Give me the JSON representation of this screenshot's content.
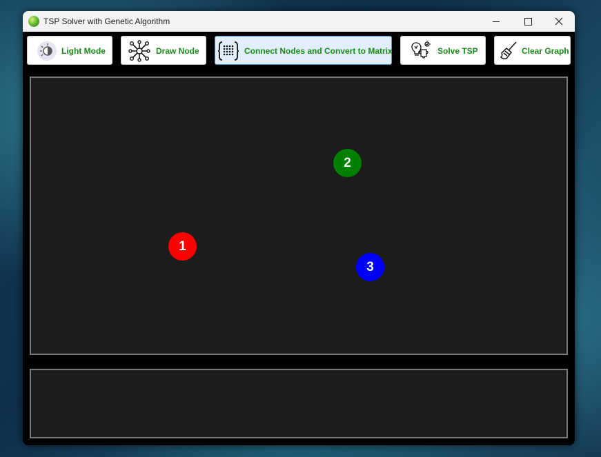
{
  "window": {
    "title": "TSP Solver with Genetic Algorithm"
  },
  "toolbar": {
    "buttons": [
      {
        "label": "Light Mode",
        "icon": "light-mode-icon",
        "active": false
      },
      {
        "label": "Draw Node",
        "icon": "network-nodes-icon",
        "active": false
      },
      {
        "label": "Connect Nodes and Convert to Matrix",
        "icon": "matrix-braces-icon",
        "active": true
      },
      {
        "label": "Solve TSP",
        "icon": "lightbulb-puzzle-icon",
        "active": false
      },
      {
        "label": "Clear Graph",
        "icon": "broom-icon",
        "active": false
      }
    ]
  },
  "canvas": {
    "nodes": [
      {
        "label": "1",
        "color": "#ff0000"
      },
      {
        "label": "2",
        "color": "#008000"
      },
      {
        "label": "3",
        "color": "#0000ff"
      }
    ]
  },
  "colors": {
    "button_text": "#1a8a1a",
    "canvas_bg": "#1c1c1c",
    "canvas_border": "#7a7a7a",
    "active_button_bg": "#e2eefa"
  }
}
